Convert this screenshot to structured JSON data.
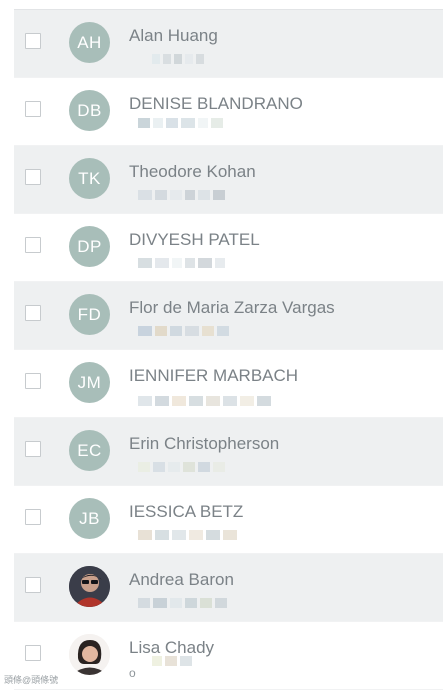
{
  "contacts": [
    {
      "initials": "AH",
      "name": "Alan Huang",
      "shaded": true
    },
    {
      "initials": "DB",
      "name": "DENISE BLANDRANO",
      "shaded": false
    },
    {
      "initials": "TK",
      "name": "Theodore Kohan",
      "shaded": true
    },
    {
      "initials": "DP",
      "name": "DIVYESH PATEL",
      "shaded": false
    },
    {
      "initials": "FD",
      "name": "Flor de Maria Zarza Vargas",
      "shaded": true
    },
    {
      "initials": "JM",
      "name": "IENNIFER MARBACH",
      "shaded": false
    },
    {
      "initials": "EC",
      "name": "Erin Christopherson",
      "shaded": true
    },
    {
      "initials": "JB",
      "name": "IESSICA BETZ",
      "shaded": false
    },
    {
      "initials": "",
      "name": "Andrea Baron",
      "shaded": true,
      "photo": "person-photo-1"
    },
    {
      "initials": "",
      "name": "Lisa Chady",
      "shaded": false,
      "photo": "person-photo-2",
      "sub": "o"
    }
  ],
  "footer": {
    "watermark": "頭條@頭條號"
  }
}
